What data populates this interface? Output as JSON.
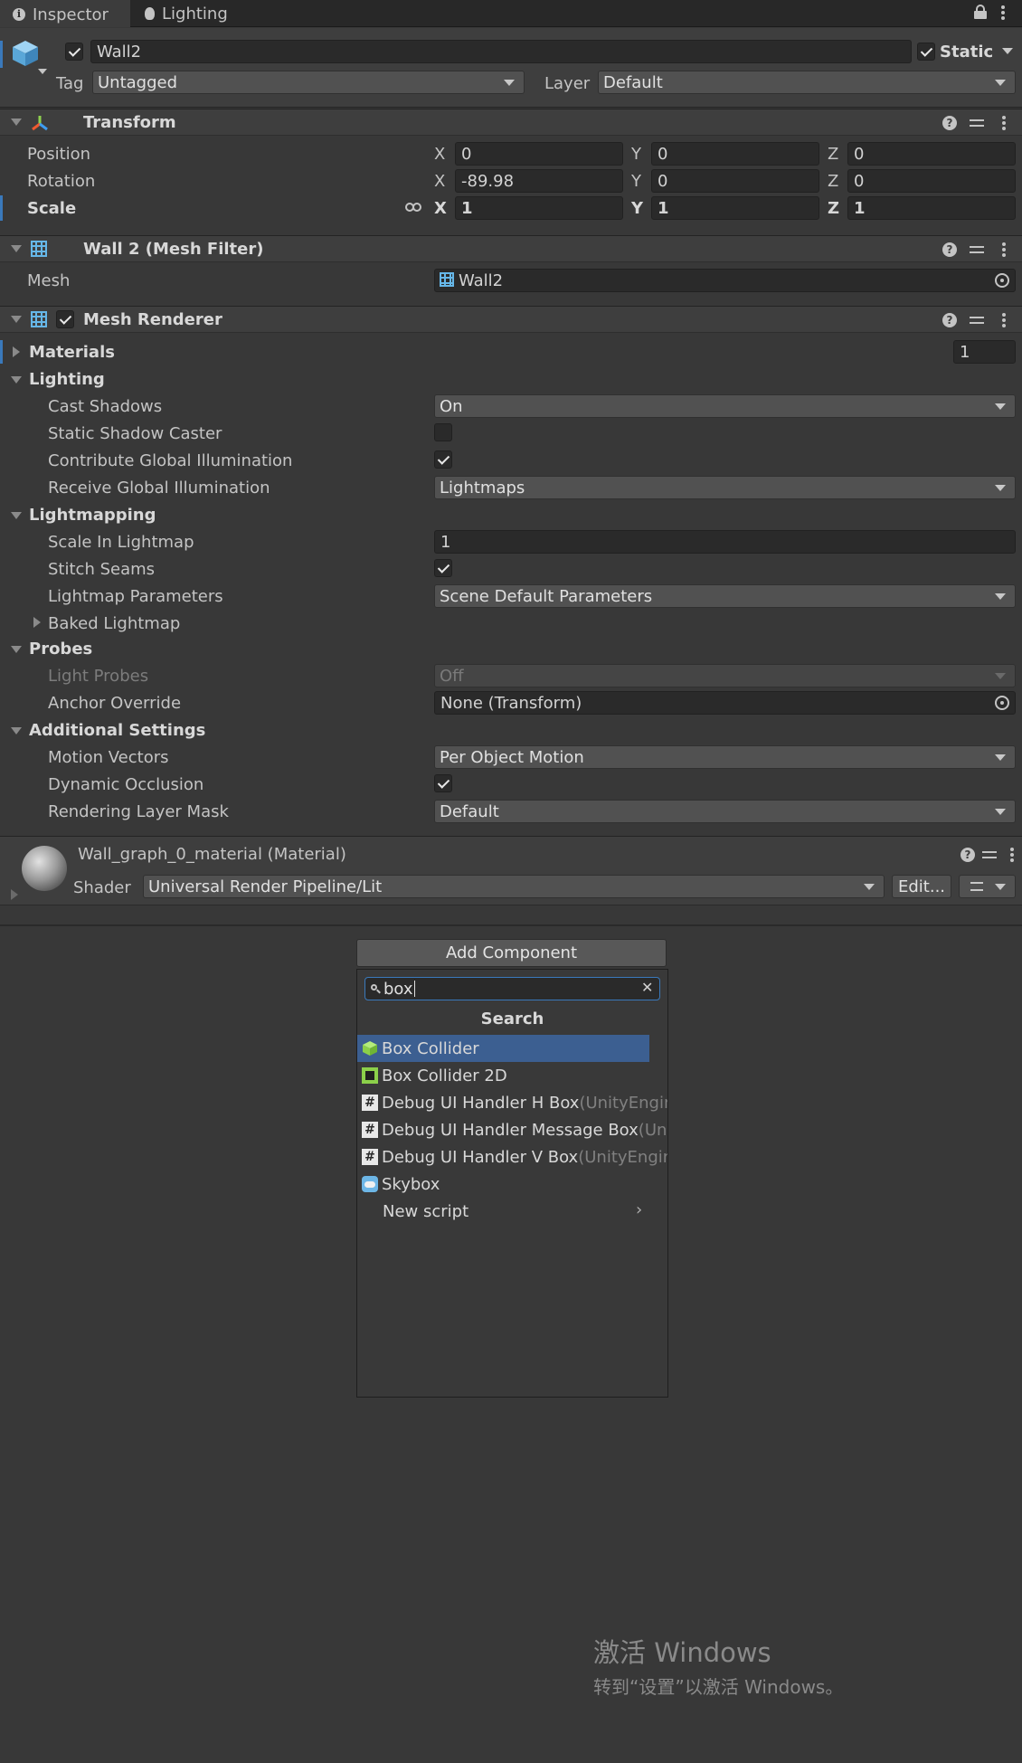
{
  "tabs": [
    {
      "label": "Inspector",
      "icon": "info-icon"
    },
    {
      "label": "Lighting",
      "icon": "lightbulb-icon"
    }
  ],
  "header": {
    "object_name": "Wall2",
    "static_label": "Static",
    "tag_label": "Tag",
    "tag_value": "Untagged",
    "layer_label": "Layer",
    "layer_value": "Default"
  },
  "transform": {
    "title": "Transform",
    "rows": [
      {
        "label": "Position",
        "x": "0",
        "y": "0",
        "z": "0"
      },
      {
        "label": "Rotation",
        "x": "-89.98",
        "y": "0",
        "z": "0"
      },
      {
        "label": "Scale",
        "x": "1",
        "y": "1",
        "z": "1"
      }
    ],
    "axis": {
      "x": "X",
      "y": "Y",
      "z": "Z"
    }
  },
  "mesh_filter": {
    "title": "Wall 2 (Mesh Filter)",
    "mesh_label": "Mesh",
    "mesh_value": "Wall2"
  },
  "mesh_renderer": {
    "title": "Mesh Renderer",
    "materials_label": "Materials",
    "materials_count": "1",
    "lighting_label": "Lighting",
    "cast_shadows_label": "Cast Shadows",
    "cast_shadows_value": "On",
    "static_shadow_caster_label": "Static Shadow Caster",
    "contribute_gi_label": "Contribute Global Illumination",
    "receive_gi_label": "Receive Global Illumination",
    "receive_gi_value": "Lightmaps",
    "lightmapping_label": "Lightmapping",
    "scale_in_lightmap_label": "Scale In Lightmap",
    "scale_in_lightmap_value": "1",
    "stitch_seams_label": "Stitch Seams",
    "lightmap_params_label": "Lightmap Parameters",
    "lightmap_params_value": "Scene Default Parameters",
    "baked_lightmap_label": "Baked Lightmap",
    "probes_label": "Probes",
    "light_probes_label": "Light Probes",
    "light_probes_value": "Off",
    "anchor_override_label": "Anchor Override",
    "anchor_override_value": "None (Transform)",
    "additional_label": "Additional Settings",
    "motion_vectors_label": "Motion Vectors",
    "motion_vectors_value": "Per Object Motion",
    "dynamic_occlusion_label": "Dynamic Occlusion",
    "rendering_layer_mask_label": "Rendering Layer Mask",
    "rendering_layer_mask_value": "Default"
  },
  "material": {
    "title": "Wall_graph_0_material (Material)",
    "shader_label": "Shader",
    "shader_value": "Universal Render Pipeline/Lit",
    "edit_label": "Edit..."
  },
  "add_component": {
    "button_label": "Add Component",
    "search_value": "box",
    "section_title": "Search",
    "items": [
      {
        "label": "Box Collider",
        "suffix": "",
        "icon": "box-collider-icon"
      },
      {
        "label": "Box Collider 2D",
        "suffix": "",
        "icon": "box-collider-2d-icon"
      },
      {
        "label": "Debug UI Handler H Box ",
        "suffix": "(UnityEngine",
        "icon": "script-icon"
      },
      {
        "label": "Debug UI Handler Message Box ",
        "suffix": "(UnityEngine",
        "icon": "script-icon"
      },
      {
        "label": "Debug UI Handler V Box ",
        "suffix": "(UnityEngine",
        "icon": "script-icon"
      },
      {
        "label": "Skybox",
        "suffix": "",
        "icon": "skybox-icon"
      }
    ],
    "new_script_label": "New script"
  },
  "watermark": {
    "line1": "激活 Windows",
    "line2": "转到“设置”以激活 Windows。"
  },
  "colors": {
    "accent": "#3a79bb",
    "selected_row": "#3c5f91",
    "background": "#383838"
  }
}
